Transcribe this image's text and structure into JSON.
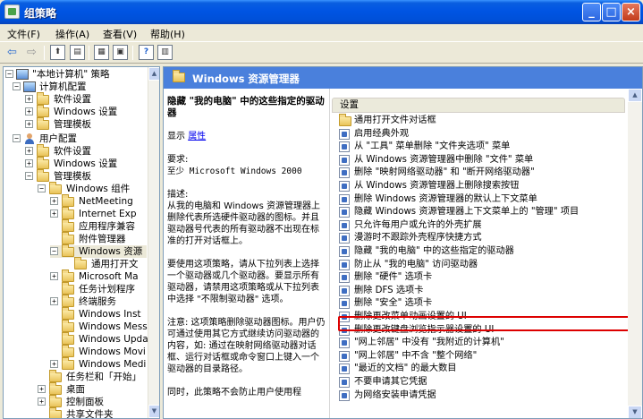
{
  "window": {
    "title": "组策略"
  },
  "menu": [
    "文件(F)",
    "操作(A)",
    "查看(V)",
    "帮助(H)"
  ],
  "tree": {
    "items": [
      {
        "label": "\"本地计算机\" 策略"
      },
      {
        "label": "计算机配置"
      },
      {
        "label": "软件设置"
      },
      {
        "label": "Windows 设置"
      },
      {
        "label": "管理模板"
      },
      {
        "label": "用户配置"
      },
      {
        "label": "软件设置"
      },
      {
        "label": "Windows 设置"
      },
      {
        "label": "管理模板"
      },
      {
        "label": "Windows 组件"
      },
      {
        "label": "NetMeeting"
      },
      {
        "label": "Internet Exp"
      },
      {
        "label": "应用程序兼容"
      },
      {
        "label": "附件管理器"
      },
      {
        "label": "Windows 资源"
      },
      {
        "label": "通用打开文"
      },
      {
        "label": "Microsoft Ma"
      },
      {
        "label": "任务计划程序"
      },
      {
        "label": "终端服务"
      },
      {
        "label": "Windows Inst"
      },
      {
        "label": "Windows Mess"
      },
      {
        "label": "Windows Upda"
      },
      {
        "label": "Windows Movi"
      },
      {
        "label": "Windows Medi"
      },
      {
        "label": "任务栏和「开始」"
      },
      {
        "label": "桌面"
      },
      {
        "label": "控制面板"
      },
      {
        "label": "共享文件夹"
      }
    ]
  },
  "content": {
    "title": "Windows 资源管理器"
  },
  "desc": {
    "title": "隐藏 \"我的电脑\" 中的这些指定的驱动器",
    "show": "显示",
    "show_link": "属性",
    "req_label": "要求:",
    "req_text": "至少 Microsoft Windows 2000",
    "desc_label": "描述:",
    "desc_text": "从我的电脑和 Windows 资源管理器上删除代表所选硬件驱动器的图标。并且驱动器号代表的所有驱动器不出现在标准的打开对话框上。",
    "use_text": "要使用这项策略，请从下拉列表上选择一个驱动器或几个驱动器。要显示所有驱动器，请禁用这项策略或从下拉列表中选择 \"不限制驱动器\" 选项。",
    "note_text": "注意: 这项策略删除驱动器图标。用户仍可通过使用其它方式继续访问驱动器的内容，如: 通过在映射网络驱动器对话框、运行对话框或命令窗口上键入一个驱动器的目录路径。",
    "more_text": "同时，此策略不会防止用户使用程"
  },
  "list": {
    "header": "设置",
    "items": [
      {
        "label": "通用打开文件对话框",
        "type": "folder"
      },
      {
        "label": "启用经典外观",
        "type": "policy"
      },
      {
        "label": "从 \"工具\" 菜单删除 \"文件夹选项\" 菜单",
        "type": "policy"
      },
      {
        "label": "从 Windows 资源管理器中删除 \"文件\" 菜单",
        "type": "policy"
      },
      {
        "label": "删除 \"映射网络驱动器\" 和 \"断开网络驱动器\"",
        "type": "policy"
      },
      {
        "label": "从 Windows 资源管理器上删除搜索按钮",
        "type": "policy"
      },
      {
        "label": "删除 Windows 资源管理器的默认上下文菜单",
        "type": "policy"
      },
      {
        "label": "隐藏 Windows 资源管理器上下文菜单上的 \"管理\" 项目",
        "type": "policy"
      },
      {
        "label": "只允许每用户或允许的外壳扩展",
        "type": "policy"
      },
      {
        "label": "漫游时不跟踪外壳程序快捷方式",
        "type": "policy"
      },
      {
        "label": "隐藏 \"我的电脑\" 中的这些指定的驱动器",
        "type": "policy"
      },
      {
        "label": "防止从 \"我的电脑\" 访问驱动器",
        "type": "policy"
      },
      {
        "label": "删除 \"硬件\" 选项卡",
        "type": "policy"
      },
      {
        "label": "删除 DFS 选项卡",
        "type": "policy"
      },
      {
        "label": "删除 \"安全\" 选项卡",
        "type": "policy"
      },
      {
        "label": "删除更改菜单动画设置的 UI",
        "type": "policy"
      },
      {
        "label": "删除更改键盘浏览指示器设置的 UI",
        "type": "policy"
      },
      {
        "label": "\"网上邻居\" 中没有 \"我附近的计算机\"",
        "type": "policy"
      },
      {
        "label": "\"网上邻居\" 中不含 \"整个网络\"",
        "type": "policy"
      },
      {
        "label": "\"最近的文档\" 的最大数目",
        "type": "policy"
      },
      {
        "label": "不要申请其它凭据",
        "type": "policy"
      },
      {
        "label": "为网络安装申请凭据",
        "type": "policy"
      }
    ]
  }
}
